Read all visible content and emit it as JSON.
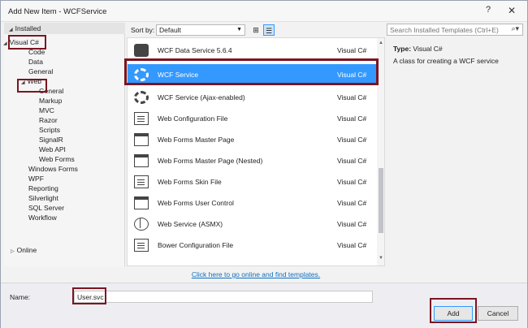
{
  "window": {
    "title": "Add New Item - WCFService",
    "help_glyph": "?",
    "close_glyph": "✕"
  },
  "left": {
    "installed_label": "Installed",
    "tree": [
      {
        "label": "Visual C#",
        "indent": 0,
        "expander": "◢"
      },
      {
        "label": "Code",
        "indent": 1
      },
      {
        "label": "Data",
        "indent": 1
      },
      {
        "label": "General",
        "indent": 1
      },
      {
        "label": "Web",
        "indent": 1,
        "expander": "◢"
      },
      {
        "label": "General",
        "indent": 2
      },
      {
        "label": "Markup",
        "indent": 2
      },
      {
        "label": "MVC",
        "indent": 2
      },
      {
        "label": "Razor",
        "indent": 2
      },
      {
        "label": "Scripts",
        "indent": 2
      },
      {
        "label": "SignalR",
        "indent": 2
      },
      {
        "label": "Web API",
        "indent": 2
      },
      {
        "label": "Web Forms",
        "indent": 2
      },
      {
        "label": "Windows Forms",
        "indent": 1
      },
      {
        "label": "WPF",
        "indent": 1
      },
      {
        "label": "Reporting",
        "indent": 1
      },
      {
        "label": "Silverlight",
        "indent": 1
      },
      {
        "label": "SQL Server",
        "indent": 1
      },
      {
        "label": "Workflow",
        "indent": 1
      }
    ],
    "online_label": "Online",
    "online_expander": "▷"
  },
  "middle": {
    "sort_label": "Sort by:",
    "sort_value": "Default",
    "templates": [
      {
        "name": "WCF Data Service 5.6.4",
        "lang": "Visual C#",
        "icon": "database-icon"
      },
      {
        "name": "WCF Service",
        "lang": "Visual C#",
        "icon": "gear-icon",
        "selected": true
      },
      {
        "name": "WCF Service (Ajax-enabled)",
        "lang": "Visual C#",
        "icon": "gear-icon"
      },
      {
        "name": "Web Configuration File",
        "lang": "Visual C#",
        "icon": "config-file-icon"
      },
      {
        "name": "Web Forms Master Page",
        "lang": "Visual C#",
        "icon": "page-icon"
      },
      {
        "name": "Web Forms Master Page (Nested)",
        "lang": "Visual C#",
        "icon": "page-icon"
      },
      {
        "name": "Web Forms Skin File",
        "lang": "Visual C#",
        "icon": "file-icon"
      },
      {
        "name": "Web Forms User Control",
        "lang": "Visual C#",
        "icon": "page-icon"
      },
      {
        "name": "Web Service (ASMX)",
        "lang": "Visual C#",
        "icon": "globe-icon"
      },
      {
        "name": "Bower Configuration File",
        "lang": "Visual C#",
        "icon": "config-file-icon"
      }
    ],
    "online_link": "Click here to go online and find templates."
  },
  "right": {
    "search_placeholder": "Search Installed Templates (Ctrl+E)",
    "type_key": "Type:",
    "type_value": "Visual C#",
    "description": "A class for creating a WCF service"
  },
  "bottom": {
    "name_label": "Name:",
    "name_value": "User.svc",
    "add_label": "Add",
    "cancel_label": "Cancel"
  }
}
